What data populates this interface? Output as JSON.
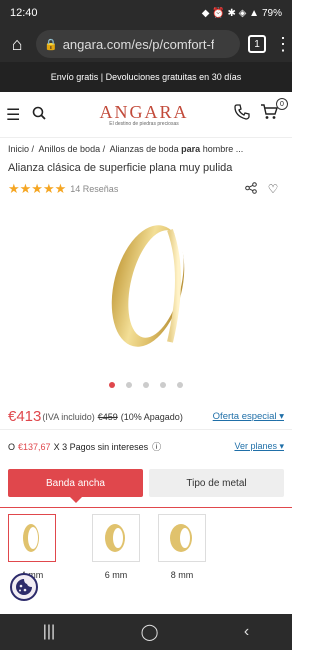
{
  "status": {
    "time": "12:40",
    "battery": "79%"
  },
  "browser": {
    "url": "angara.com/es/p/comfort-f",
    "tabs": "1"
  },
  "promo": "Envío gratis | Devoluciones gratuitas en 30 días",
  "header": {
    "logo": "ANGARA",
    "tagline": "El destino de piedras preciosas",
    "cart_count": "0"
  },
  "breadcrumb": {
    "items": [
      "Inicio",
      "Anillos de boda",
      "Alianzas de boda"
    ],
    "bold": "para",
    "tail": "hombre ..."
  },
  "product": {
    "title": "Alianza clásica de superficie plana muy pulida",
    "stars": "★★★★★",
    "reviews": "14 Reseñas"
  },
  "price": {
    "current": "€413",
    "iva": "(IVA incluido)",
    "old": "€459",
    "discount": "(10% Apagado)",
    "special": "Oferta especial"
  },
  "payment": {
    "prefix": "O",
    "amount": "€137,67",
    "text": "X 3 Pagos sin intereses",
    "plans": "Ver planes"
  },
  "segments": {
    "active": "Banda ancha",
    "inactive": "Tipo de metal"
  },
  "widths": [
    {
      "label": "4 mm"
    },
    {
      "label": "6 mm"
    },
    {
      "label": "8 mm"
    }
  ],
  "colors": {
    "accent": "#e0474c",
    "gold": "#e6c96a",
    "link": "#1f6fa8"
  }
}
